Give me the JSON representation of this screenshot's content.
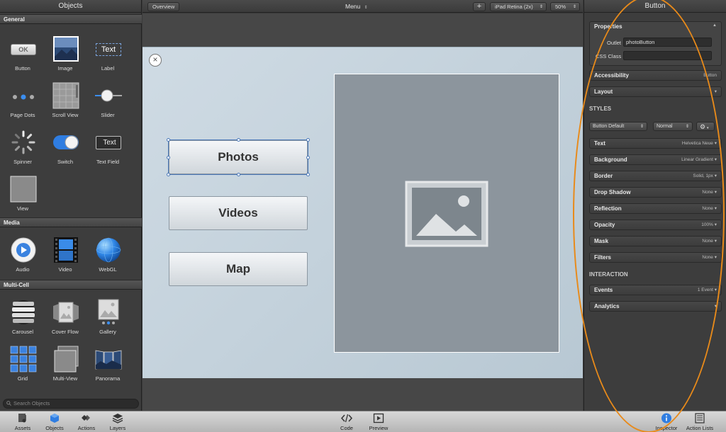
{
  "left_panel": {
    "title": "Objects",
    "sections": {
      "general": "General",
      "media": "Media",
      "multicell": "Multi-Cell"
    },
    "general_items": [
      "Button",
      "Image",
      "Label",
      "Page Dots",
      "Scroll View",
      "Slider",
      "Spinner",
      "Switch",
      "Text Field",
      "View"
    ],
    "media_items": [
      "Audio",
      "Video",
      "WebGL"
    ],
    "multicell_items": [
      "Carousel",
      "Cover Flow",
      "Gallery",
      "Grid",
      "Multi-View",
      "Panorama"
    ],
    "icon_texts": {
      "ok": "OK",
      "text": "Text",
      "textfield": "Text"
    },
    "search_placeholder": "Search Objects"
  },
  "top_bar": {
    "overview": "Overview",
    "title": "Menu",
    "device": "iPad Retina (2x)",
    "zoom": "50%"
  },
  "canvas": {
    "close_glyph": "×",
    "buttons": [
      "Photos",
      "Videos",
      "Map"
    ]
  },
  "inspector": {
    "title": "Button",
    "properties_label": "Properties",
    "outlet_label": "Outlet",
    "outlet_value": "photoButton",
    "css_class_label": "CSS Class",
    "css_class_value": "",
    "accessibility": {
      "label": "Accessibility",
      "value": "Button"
    },
    "layout": {
      "label": "Layout"
    },
    "styles_header": "STYLES",
    "style_preset": "Button Default",
    "style_state": "Normal",
    "style_rows": [
      {
        "label": "Text",
        "value": "Helvetica Neue"
      },
      {
        "label": "Background",
        "value": "Linear Gradient"
      },
      {
        "label": "Border",
        "value": "Solid, 1px"
      },
      {
        "label": "Drop Shadow",
        "value": "None"
      },
      {
        "label": "Reflection",
        "value": "None"
      },
      {
        "label": "Opacity",
        "value": "100%"
      },
      {
        "label": "Mask",
        "value": "None"
      },
      {
        "label": "Filters",
        "value": "None"
      }
    ],
    "interaction_header": "INTERACTION",
    "events": {
      "label": "Events",
      "value": "1 Event"
    },
    "analytics": {
      "label": "Analytics"
    }
  },
  "bottom_bar": {
    "assets": "Assets",
    "objects": "Objects",
    "actions": "Actions",
    "layers": "Layers",
    "code": "Code",
    "preview": "Preview",
    "inspector": "Inspector",
    "action_lists": "Action Lists"
  },
  "colors": {
    "annotation_ellipse": "#e88a1a",
    "selection": "#4a78b8",
    "accent_blue": "#2f7de1"
  }
}
